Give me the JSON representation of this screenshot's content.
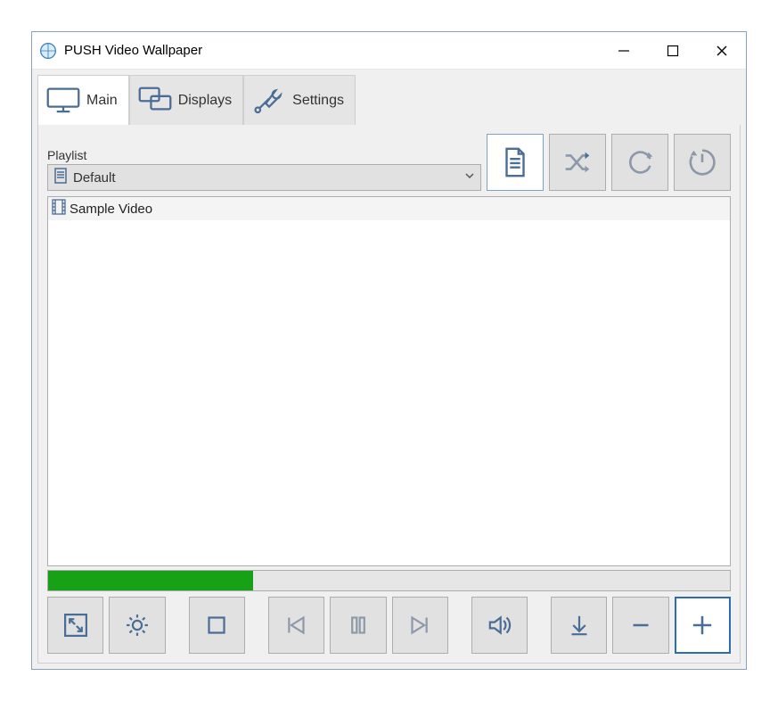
{
  "window": {
    "title": "PUSH Video Wallpaper"
  },
  "tabs": {
    "main": "Main",
    "displays": "Displays",
    "settings": "Settings"
  },
  "playlist": {
    "label": "Playlist",
    "selected": "Default"
  },
  "list": {
    "items": [
      {
        "label": "Sample Video"
      }
    ]
  },
  "progress": {
    "percent": 30
  },
  "colors": {
    "icon_stroke": "#4b6d95",
    "icon_stroke_dim": "#8d99a8",
    "progress_fill": "#16a116",
    "window_border": "#86a1c2"
  }
}
